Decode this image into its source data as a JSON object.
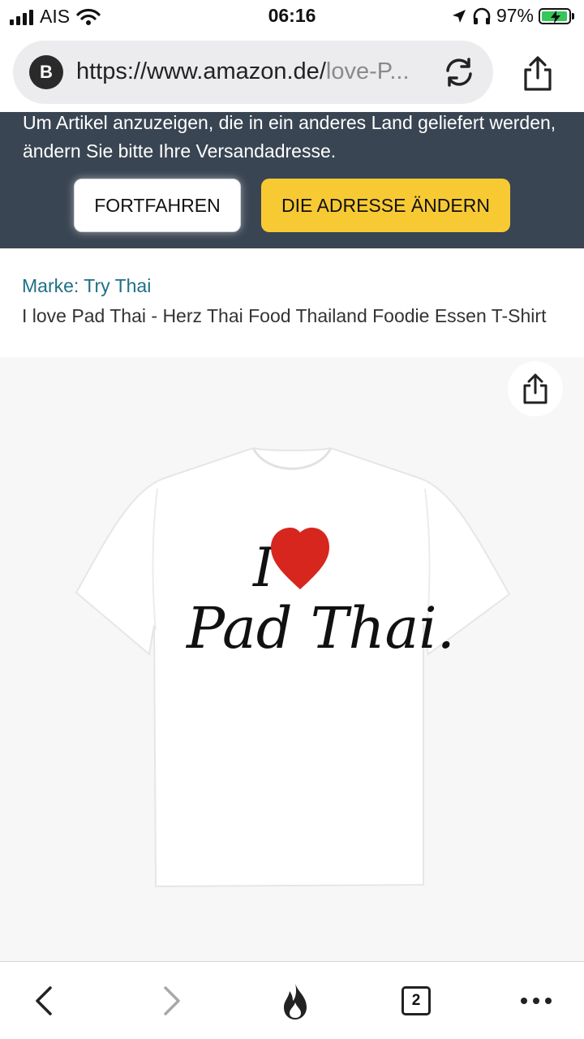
{
  "status_bar": {
    "carrier": "AIS",
    "time": "06:16",
    "battery_percent": "97%",
    "battery_level": 0.97,
    "icons": [
      "signal-icon",
      "wifi-icon",
      "location-arrow-icon",
      "headphones-icon",
      "battery-charging-icon"
    ]
  },
  "browser": {
    "badge_letter": "B",
    "url_main": "https://www.amazon.de/",
    "url_rest": "love-P...",
    "icons": [
      "reload-icon",
      "share-icon"
    ]
  },
  "notice": {
    "text": "Um Artikel anzuzeigen, die in ein anderes Land geliefert werden, ändern Sie bitte Ihre Versandadresse.",
    "continue_label": "FORTFAHREN",
    "change_address_label": "DIE ADRESSE ÄNDERN"
  },
  "product": {
    "brand_link": "Marke: Try Thai",
    "title": "I love Pad Thai - Herz Thai Food Thailand Foodie Essen T-Shirt",
    "print_text_top": "I",
    "print_text_bottom": "Pad Thai.",
    "heart_color": "#d7261e"
  },
  "toolbar": {
    "tab_count": "2",
    "icons": [
      "back-arrow-icon",
      "forward-arrow-icon",
      "flame-icon",
      "tabs-icon",
      "more-dots-icon"
    ]
  },
  "colors": {
    "banner_bg": "#3a4553",
    "primary_button": "#f7ca34",
    "link": "#1f6f86"
  }
}
